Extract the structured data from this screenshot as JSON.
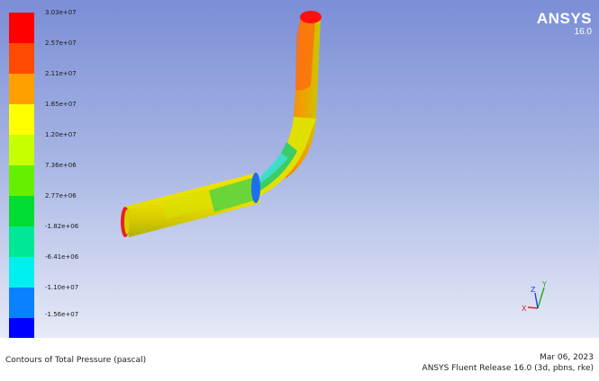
{
  "legend": {
    "levels": [
      {
        "label": "3.03e+07",
        "color": "#ff0000"
      },
      {
        "label": "2.57e+07",
        "color": "#ff4a00"
      },
      {
        "label": "2.11e+07",
        "color": "#ffa000"
      },
      {
        "label": "1.65e+07",
        "color": "#ffff00"
      },
      {
        "label": "1.20e+07",
        "color": "#c8ff00"
      },
      {
        "label": "7.36e+06",
        "color": "#64f000"
      },
      {
        "label": "2.77e+06",
        "color": "#00dc32"
      },
      {
        "label": "-1.82e+06",
        "color": "#00e896"
      },
      {
        "label": "-6.41e+06",
        "color": "#00f0f0"
      },
      {
        "label": "-1.10e+07",
        "color": "#0a82ff"
      },
      {
        "label": "-1.56e+07",
        "color": "#0000ff"
      }
    ]
  },
  "brand": {
    "name": "ANSYS",
    "version": "16.0"
  },
  "axes": {
    "x": "X",
    "y": "Y",
    "z": "Z"
  },
  "footer": {
    "title": "Contours of Total Pressure (pascal)",
    "date": "Mar 06, 2023",
    "release": "ANSYS Fluent Release 16.0 (3d, pbns, rke)"
  }
}
